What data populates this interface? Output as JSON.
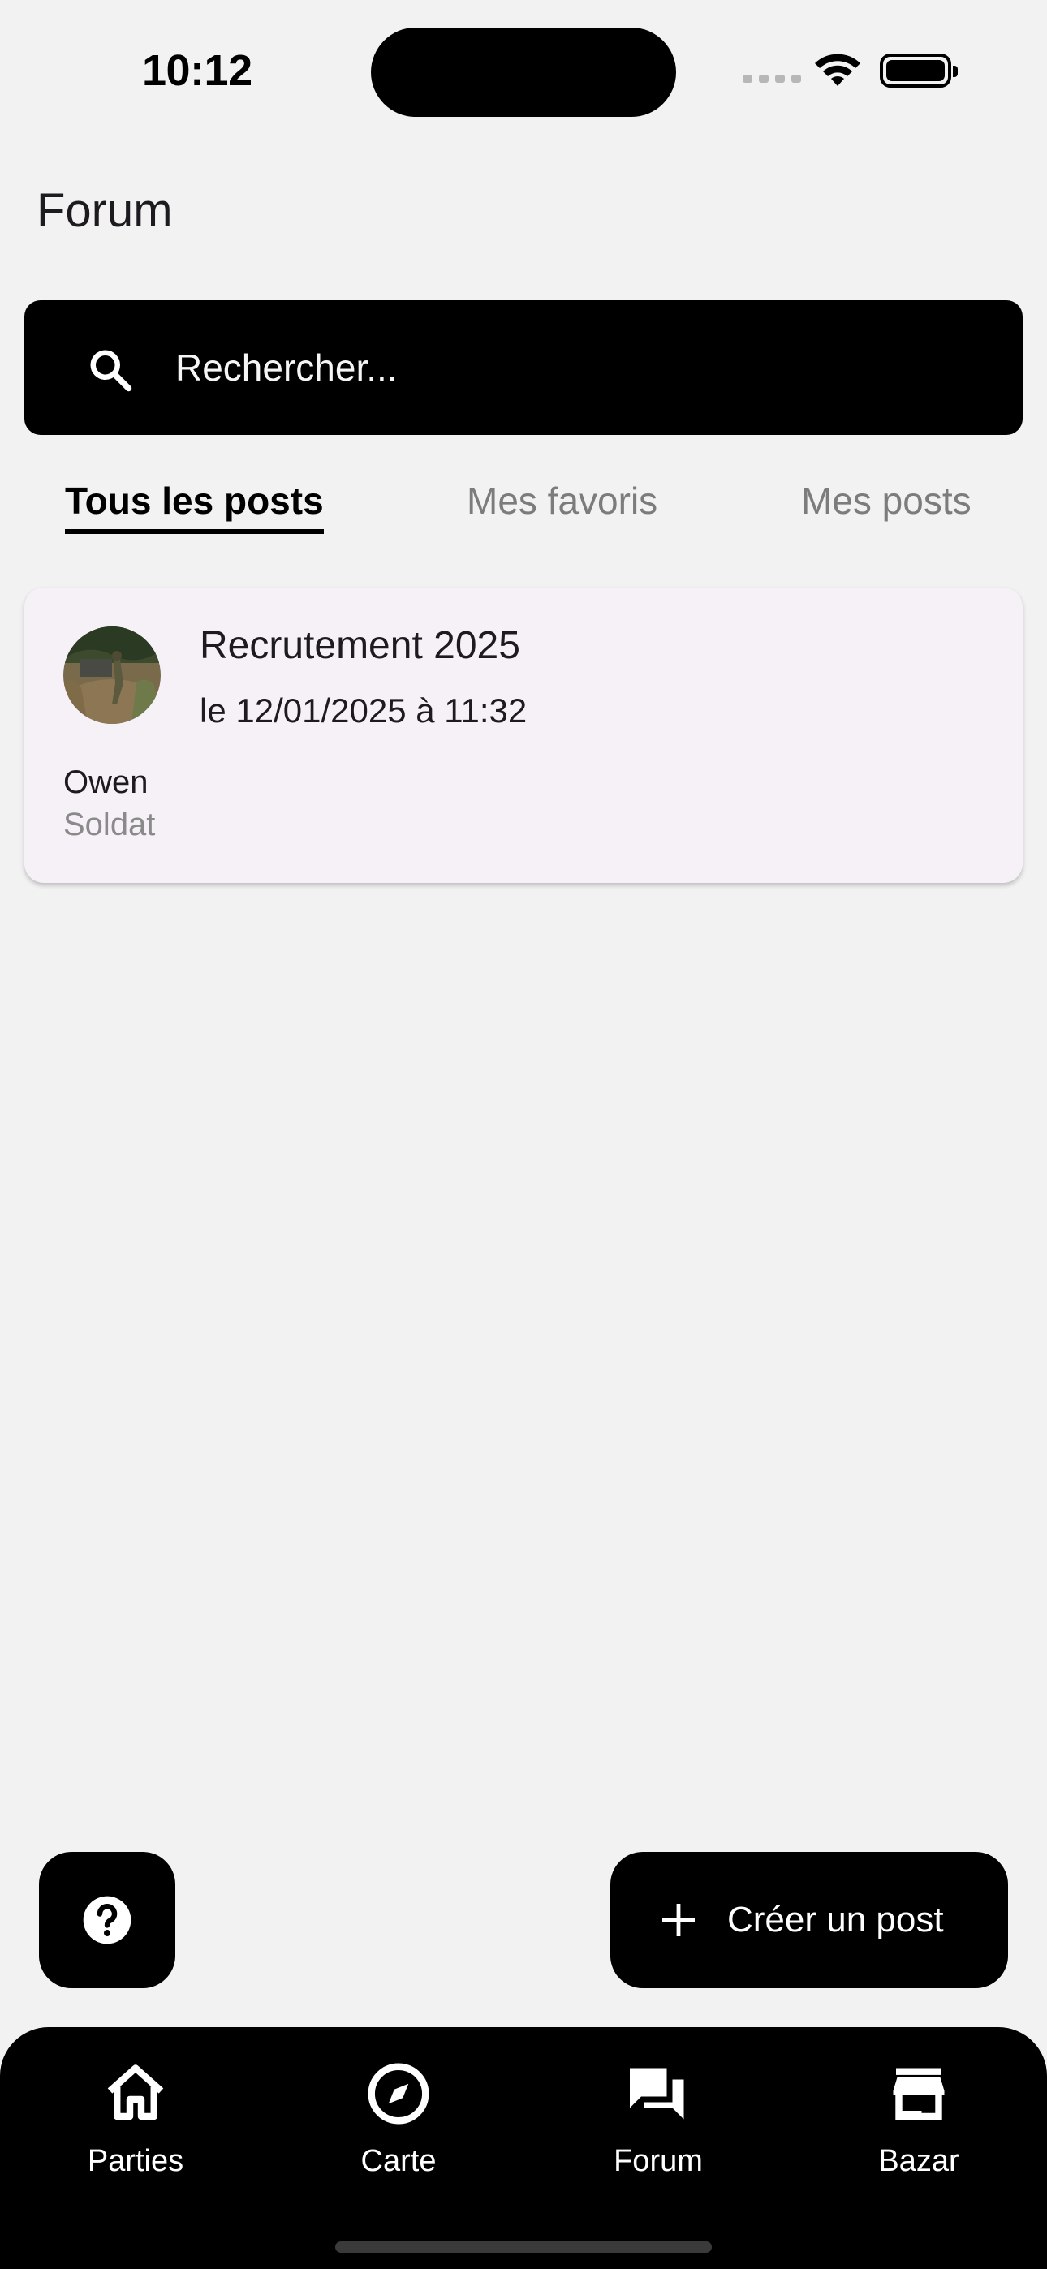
{
  "status_bar": {
    "time": "10:12"
  },
  "header": {
    "title": "Forum"
  },
  "search": {
    "placeholder": "Rechercher...",
    "icon": "search-icon"
  },
  "tabs": [
    {
      "label": "Tous les posts",
      "active": true
    },
    {
      "label": "Mes favoris",
      "active": false
    },
    {
      "label": "Mes posts",
      "active": false
    }
  ],
  "posts": [
    {
      "title": "Recrutement 2025",
      "date": "le 12/01/2025 à 11:32",
      "author": "Owen",
      "rank": "Soldat",
      "avatar": "avatar-photo"
    }
  ],
  "actions": {
    "help_icon": "help-circle-icon",
    "create_label": "Créer un post",
    "create_icon": "plus-icon"
  },
  "bottom_nav": [
    {
      "label": "Parties",
      "icon": "home-icon"
    },
    {
      "label": "Carte",
      "icon": "compass-icon"
    },
    {
      "label": "Forum",
      "icon": "forum-icon",
      "active": true
    },
    {
      "label": "Bazar",
      "icon": "store-icon"
    }
  ]
}
